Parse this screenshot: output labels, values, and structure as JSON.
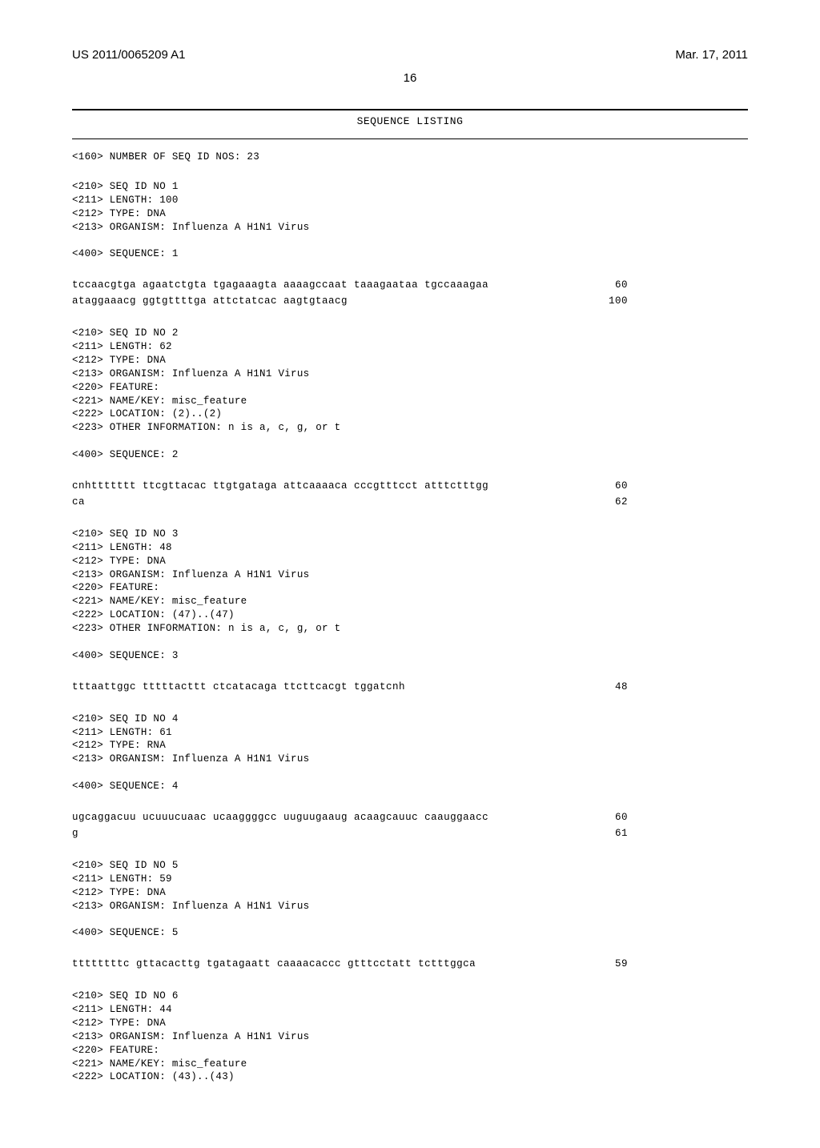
{
  "header": {
    "pubnum": "US 2011/0065209 A1",
    "date": "Mar. 17, 2011",
    "pagenum": "16"
  },
  "listing_title": "SEQUENCE LISTING",
  "num_seqs_line": "<160> NUMBER OF SEQ ID NOS: 23",
  "entries": [
    {
      "meta": [
        "<210> SEQ ID NO 1",
        "<211> LENGTH: 100",
        "<212> TYPE: DNA",
        "<213> ORGANISM: Influenza A H1N1 Virus",
        "",
        "<400> SEQUENCE: 1"
      ],
      "seqlines": [
        {
          "seq": "tccaacgtga agaatctgta tgagaaagta aaaagccaat taaagaataa tgccaaagaa",
          "num": "60"
        },
        {
          "seq": "ataggaaacg ggtgttttga attctatcac aagtgtaacg",
          "num": "100"
        }
      ]
    },
    {
      "meta": [
        "<210> SEQ ID NO 2",
        "<211> LENGTH: 62",
        "<212> TYPE: DNA",
        "<213> ORGANISM: Influenza A H1N1 Virus",
        "<220> FEATURE:",
        "<221> NAME/KEY: misc_feature",
        "<222> LOCATION: (2)..(2)",
        "<223> OTHER INFORMATION: n is a, c, g, or t",
        "",
        "<400> SEQUENCE: 2"
      ],
      "seqlines": [
        {
          "seq": "cnhttttttt ttcgttacac ttgtgataga attcaaaaca cccgtttcct atttctttgg",
          "num": "60"
        },
        {
          "seq": "ca",
          "num": "62"
        }
      ]
    },
    {
      "meta": [
        "<210> SEQ ID NO 3",
        "<211> LENGTH: 48",
        "<212> TYPE: DNA",
        "<213> ORGANISM: Influenza A H1N1 Virus",
        "<220> FEATURE:",
        "<221> NAME/KEY: misc_feature",
        "<222> LOCATION: (47)..(47)",
        "<223> OTHER INFORMATION: n is a, c, g, or t",
        "",
        "<400> SEQUENCE: 3"
      ],
      "seqlines": [
        {
          "seq": "tttaattggc tttttacttt ctcatacaga ttcttcacgt tggatcnh",
          "num": "48"
        }
      ]
    },
    {
      "meta": [
        "<210> SEQ ID NO 4",
        "<211> LENGTH: 61",
        "<212> TYPE: RNA",
        "<213> ORGANISM: Influenza A H1N1 Virus",
        "",
        "<400> SEQUENCE: 4"
      ],
      "seqlines": [
        {
          "seq": "ugcaggacuu ucuuucuaac ucaaggggcc uuguugaaug acaagcauuc caauggaacc",
          "num": "60"
        },
        {
          "seq": "g",
          "num": "61"
        }
      ]
    },
    {
      "meta": [
        "<210> SEQ ID NO 5",
        "<211> LENGTH: 59",
        "<212> TYPE: DNA",
        "<213> ORGANISM: Influenza A H1N1 Virus",
        "",
        "<400> SEQUENCE: 5"
      ],
      "seqlines": [
        {
          "seq": "ttttttttc gttacacttg tgatagaatt caaaacaccc gtttcctatt tctttggca",
          "num": "59"
        }
      ]
    },
    {
      "meta": [
        "<210> SEQ ID NO 6",
        "<211> LENGTH: 44",
        "<212> TYPE: DNA",
        "<213> ORGANISM: Influenza A H1N1 Virus",
        "<220> FEATURE:",
        "<221> NAME/KEY: misc_feature",
        "<222> LOCATION: (43)..(43)"
      ],
      "seqlines": []
    }
  ]
}
